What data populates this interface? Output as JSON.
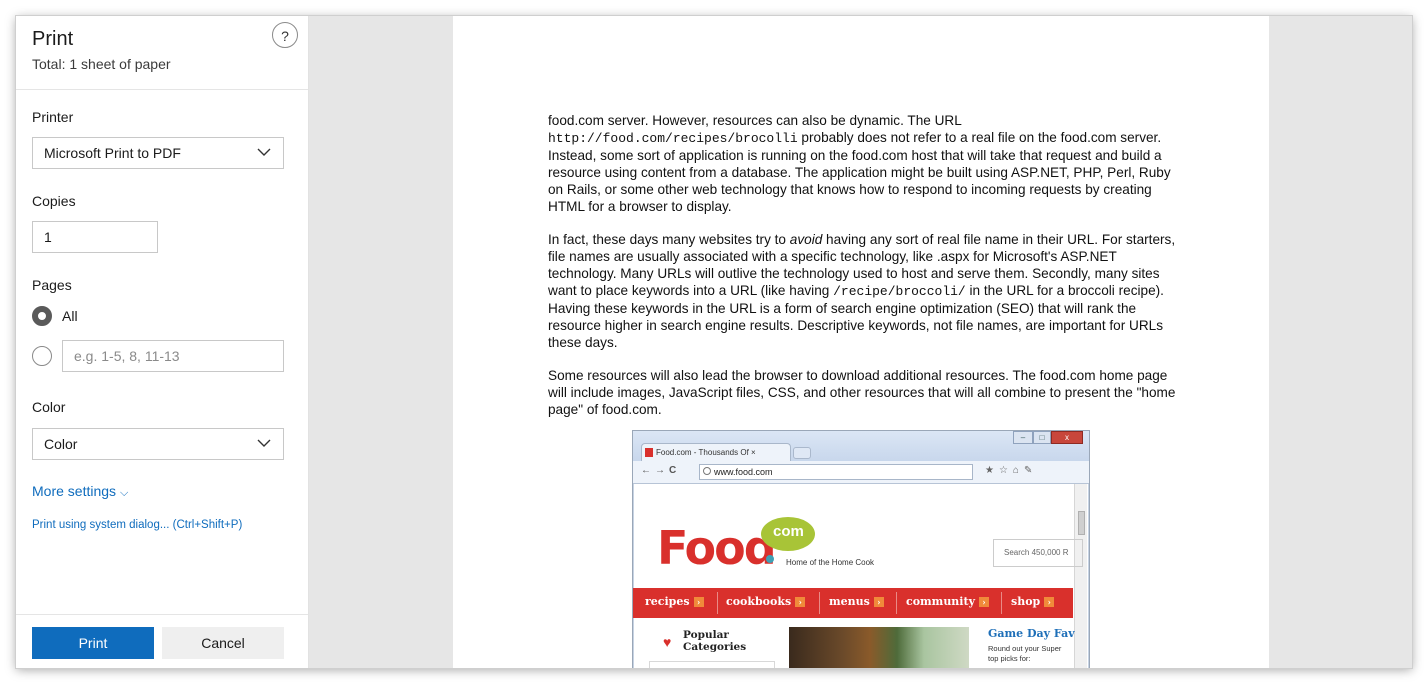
{
  "panel": {
    "title": "Print",
    "subtitle": "Total: 1 sheet of paper",
    "help_glyph": "?",
    "printer_label": "Printer",
    "printer_value": "Microsoft Print to PDF",
    "copies_label": "Copies",
    "copies_value": "1",
    "pages_label": "Pages",
    "pages_all_label": "All",
    "pages_custom_placeholder": "e.g. 1-5, 8, 11-13",
    "color_label": "Color",
    "color_value": "Color",
    "more_settings": "More settings",
    "more_settings_chevron": "⌵",
    "system_dialog": "Print using system dialog... (Ctrl+Shift+P)",
    "print_button": "Print",
    "cancel_button": "Cancel",
    "accent_color": "#0f6cbd"
  },
  "preview": {
    "p1_a": "food.com server. However, resources can also be dynamic. The URL",
    "p1_code": "http://food.com/recipes/brocolli",
    "p1_b": " probably does not refer to a real file on the food.com server. Instead, some sort of application is running on the food.com host that will take that request and build a resource using content from a database. The application might be built using ASP.NET, PHP, Perl, Ruby on Rails, or some other web technology that knows how to respond to incoming requests by creating HTML for a browser to display.",
    "p2_a": "In fact, these days many websites try to ",
    "p2_em": "avoid",
    "p2_b": " having any sort of real file name in their URL. For starters, file names are usually associated with a specific technology, like .aspx for Microsoft's ASP.NET technology. Many URLs will outlive the technology used to host and serve them. Secondly, many sites want to place keywords into a URL (like having ",
    "p2_code": "/recipe/broccoli/",
    "p2_c": " in the URL for a broccoli recipe). Having these keywords in the URL is a form of search engine optimization (SEO) that will rank the resource higher in search engine results. Descriptive keywords, not file names, are important for URLs these days.",
    "p3": "Some resources will also lead the browser to download additional resources. The food.com home page will include images, JavaScript files, CSS, and other resources that will all combine to present the \"home page\" of food.com.",
    "screenshot": {
      "tab_title": "Food.com - Thousands Of",
      "tab_close": "×",
      "url": "www.food.com",
      "win_min": "–",
      "win_max": "□",
      "win_close": "x",
      "nav_back": "←",
      "nav_forward": "→",
      "nav_reload": "C",
      "toolbar_icons": "★☆⌂✎",
      "logo_text": "Food",
      "logo_bubble": "com",
      "tagline": "Home of the Home Cook",
      "search_text": "Search 450,000 R",
      "nav_items": [
        "recipes",
        "cookbooks",
        "menus",
        "community",
        "shop"
      ],
      "nav_arrow": "›",
      "popular_line1": "Popular",
      "popular_line2": "Categories",
      "heart": "♥",
      "gameday_title": "Game Day Fav",
      "gameday_line1": "Round out your Super",
      "gameday_line2": "top picks for:"
    }
  }
}
